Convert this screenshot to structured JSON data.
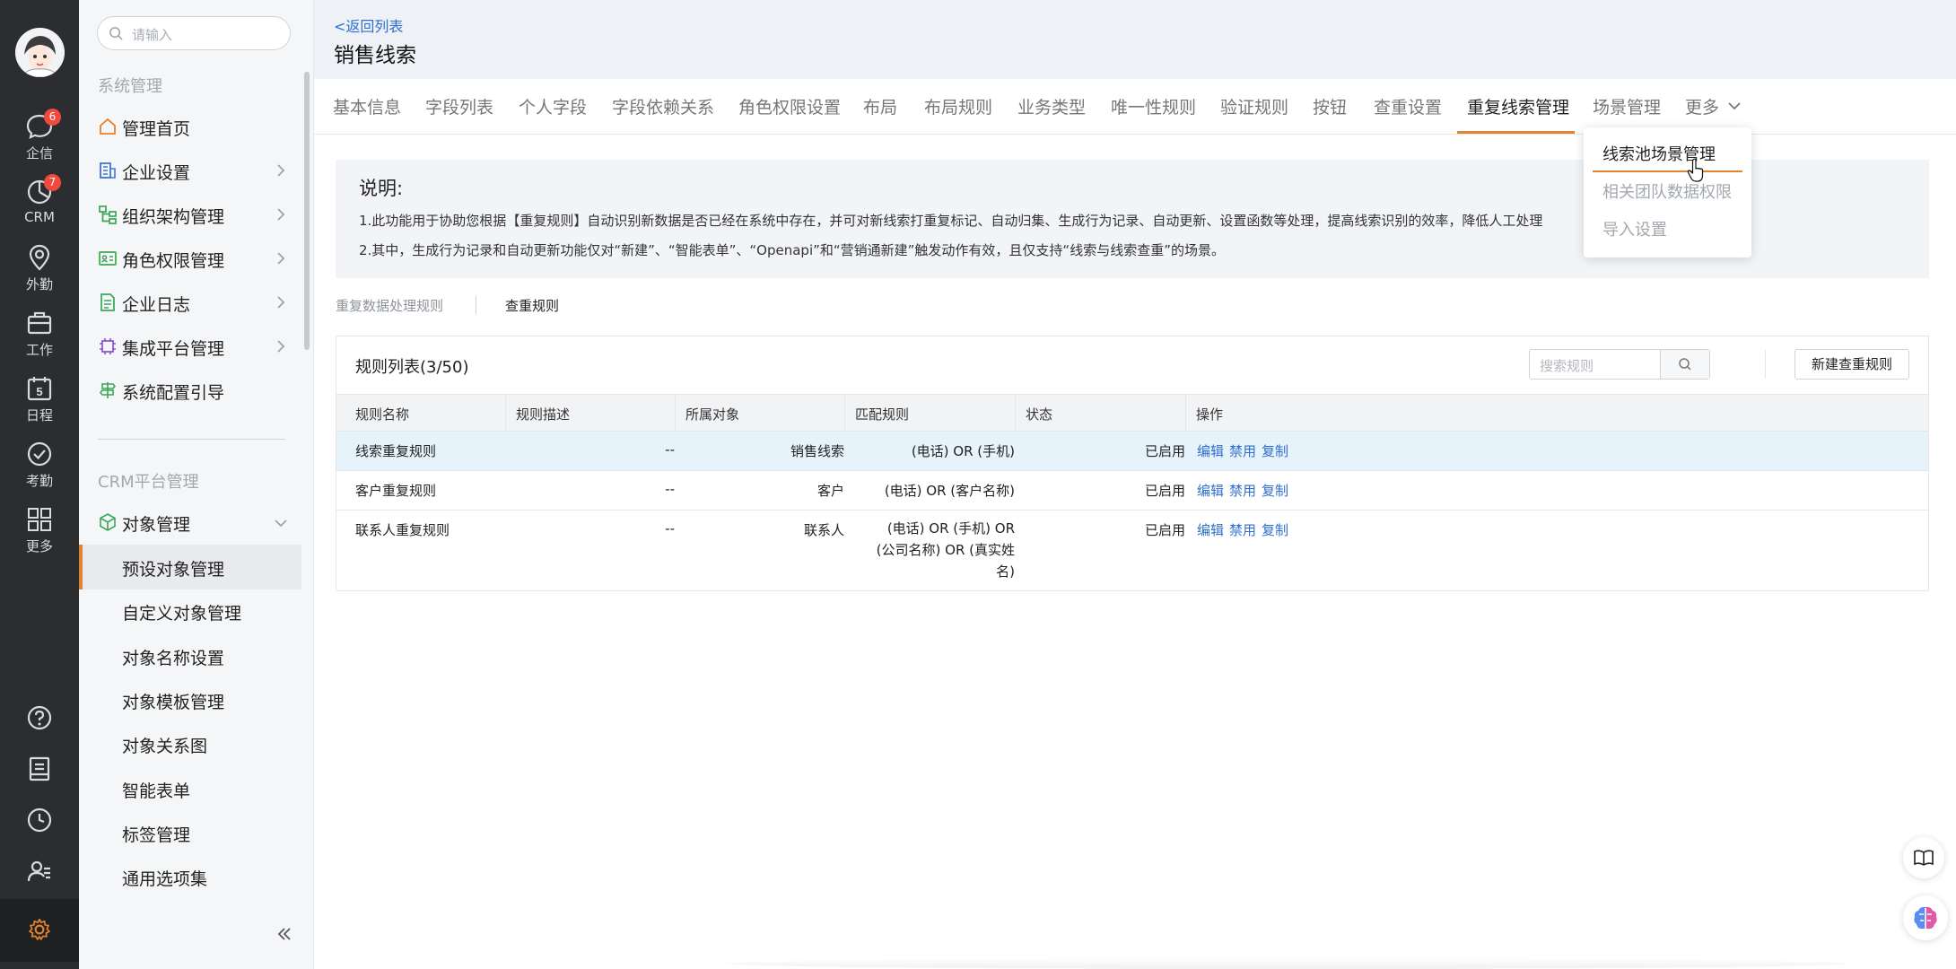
{
  "rail": {
    "items": [
      {
        "label": "企信",
        "icon": "chat-bubble-icon",
        "badge": "6"
      },
      {
        "label": "CRM",
        "icon": "crm-pie-icon",
        "badge": "7"
      },
      {
        "label": "外勤",
        "icon": "location-pin-icon",
        "badge": ""
      },
      {
        "label": "工作",
        "icon": "briefcase-icon",
        "badge": ""
      },
      {
        "label": "日程",
        "icon": "calendar-icon",
        "badge": "",
        "day": "5"
      },
      {
        "label": "考勤",
        "icon": "check-circle-icon",
        "badge": ""
      },
      {
        "label": "更多",
        "icon": "grid-icon",
        "badge": ""
      }
    ]
  },
  "menu": {
    "search_placeholder": "请输入",
    "group_system": "系统管理",
    "system_items": [
      {
        "label": "管理首页",
        "icon": "home-icon",
        "arrow": false
      },
      {
        "label": "企业设置",
        "icon": "company-icon",
        "arrow": true
      },
      {
        "label": "组织架构管理",
        "icon": "org-chart-icon",
        "arrow": true
      },
      {
        "label": "角色权限管理",
        "icon": "id-card-icon",
        "arrow": true
      },
      {
        "label": "企业日志",
        "icon": "log-document-icon",
        "arrow": true
      },
      {
        "label": "集成平台管理",
        "icon": "chip-icon",
        "arrow": true
      },
      {
        "label": "系统配置引导",
        "icon": "signpost-icon",
        "arrow": false
      }
    ],
    "group_crm": "CRM平台管理",
    "object_mgmt": "对象管理",
    "sub_items": [
      "预设对象管理",
      "自定义对象管理",
      "对象名称设置",
      "对象模板管理",
      "对象关系图",
      "智能表单",
      "标签管理",
      "通用选项集"
    ]
  },
  "header": {
    "back": "<返回列表",
    "title": "销售线索"
  },
  "tabs": [
    "基本信息",
    "字段列表",
    "个人字段",
    "字段依赖关系",
    "角色权限设置",
    "布局",
    "布局规则",
    "业务类型",
    "唯一性规则",
    "验证规则",
    "按钮",
    "查重设置",
    "重复线索管理",
    "场景管理",
    "更多"
  ],
  "active_tab": "重复线索管理",
  "dropdown": [
    "线索池场景管理",
    "相关团队数据权限",
    "导入设置"
  ],
  "note": {
    "title": "说明:",
    "line1": "1.此功能用于协助您根据【重复规则】自动识别新数据是否已经在系统中存在，并可对新线索打重复标记、自动归集、生成行为记录、自动更新、设置函数等处理，提高线索识别的效率，降低人工处理",
    "line2": "2.其中，生成行为记录和自动更新功能仅对“新建”、“智能表单”、“Openapi”和“营销通新建”触发动作有效，且仅支持“线索与线索查重”的场景。"
  },
  "subtabs": [
    "重复数据处理规则",
    "查重规则"
  ],
  "panel": {
    "title": "规则列表(3/50)",
    "search_placeholder": "搜索规则",
    "new_button": "新建查重规则",
    "columns": [
      "规则名称",
      "规则描述",
      "所属对象",
      "匹配规则",
      "状态",
      "操作"
    ],
    "rows": [
      {
        "name": "线索重复规则",
        "desc": "--",
        "object": "销售线索",
        "match": [
          "(电话) OR (手机)"
        ],
        "status": "已启用",
        "ops": [
          "编辑",
          "禁用",
          "复制"
        ]
      },
      {
        "name": "客户重复规则",
        "desc": "--",
        "object": "客户",
        "match": [
          "(电话) OR (客户名称)"
        ],
        "status": "已启用",
        "ops": [
          "编辑",
          "禁用",
          "复制"
        ]
      },
      {
        "name": "联系人重复规则",
        "desc": "--",
        "object": "联系人",
        "match": [
          "(电话) OR (手机) OR",
          "(公司名称) OR (真实姓",
          "名)"
        ],
        "status": "已启用",
        "ops": [
          "编辑",
          "禁用",
          "复制"
        ]
      }
    ]
  },
  "colors": {
    "accent": "#e2822e",
    "link": "#2f6fcd",
    "rail_bg": "#2b2d30",
    "badge": "#f04a3e",
    "row_highlight": "#e6f3fb"
  }
}
